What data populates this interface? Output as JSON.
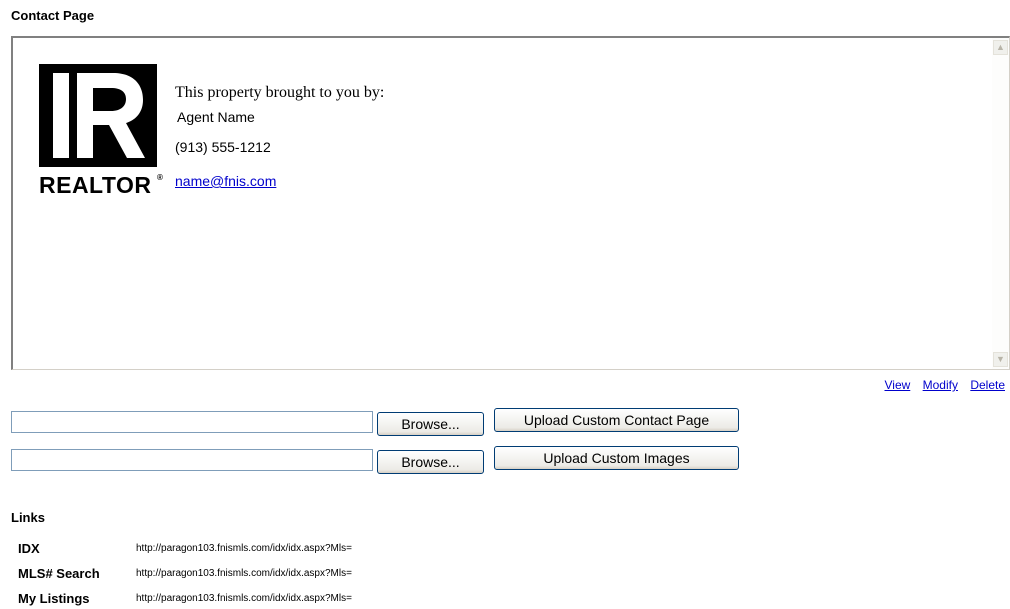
{
  "contact_section": {
    "title": "Contact Page",
    "preview": {
      "logo_word": "REALTOR",
      "logo_reg": "®",
      "byline": "This property brought to you by:",
      "agent_name": "Agent Name",
      "agent_phone": "(913) 555-1212",
      "agent_email": "name@fnis.com"
    },
    "actions": {
      "view": "View",
      "modify": "Modify",
      "delete": "Delete"
    },
    "upload_rows": [
      {
        "file_value": "",
        "browse_label": "Browse...",
        "upload_label": "Upload Custom Contact Page"
      },
      {
        "file_value": "",
        "browse_label": "Browse...",
        "upload_label": "Upload Custom Images"
      }
    ]
  },
  "links_section": {
    "title": "Links",
    "rows": [
      {
        "label": "IDX",
        "url": "http://paragon103.fnismls.com/idx/idx.aspx?Mls="
      },
      {
        "label": "MLS# Search",
        "url": "http://paragon103.fnismls.com/idx/idx.aspx?Mls="
      },
      {
        "label": "My Listings",
        "url": "http://paragon103.fnismls.com/idx/idx.aspx?Mls="
      }
    ]
  },
  "icons": {
    "scroll_up": "scroll-up-arrow-icon",
    "scroll_down": "scroll-down-arrow-icon",
    "logo": "realtor-logo-icon"
  },
  "colors": {
    "link": "#0000cc",
    "button_border": "#003c74",
    "input_border": "#7f9db9"
  }
}
